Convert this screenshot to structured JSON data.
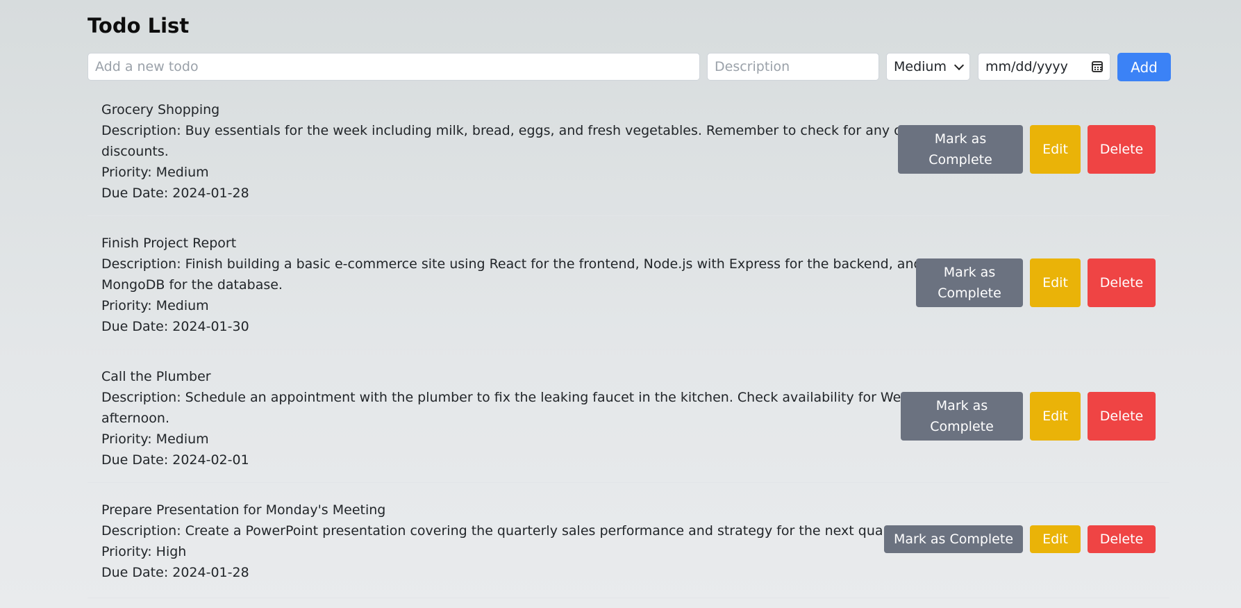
{
  "page": {
    "title": "Todo List"
  },
  "form": {
    "title_placeholder": "Add a new todo",
    "description_placeholder": "Description",
    "priority_selected": "Medium",
    "date_placeholder": "mm/dd/yyyy",
    "add_label": "Add"
  },
  "todos": [
    {
      "title": "Grocery Shopping",
      "description_line1": "Description: Buy essentials for the week including milk, bread, eggs, and fresh vegetables. Remember to check for any ongoing",
      "description_line2": "discounts.",
      "priority": "Priority: Medium",
      "due": "Due Date: 2024-01-28",
      "complete_label": "Mark as Complete",
      "edit_label": "Edit",
      "delete_label": "Delete"
    },
    {
      "title": "Finish Project Report",
      "description_line1": "Description: Finish building a basic e-commerce site using React for the frontend, Node.js with Express for the backend, and",
      "description_line2": "MongoDB for the database.",
      "priority": "Priority: Medium",
      "due": "Due Date: 2024-01-30",
      "complete_label": "Mark as Complete",
      "edit_label": "Edit",
      "delete_label": "Delete"
    },
    {
      "title": "Call the Plumber",
      "description_line1": "Description: Schedule an appointment with the plumber to fix the leaking faucet in the kitchen. Check availability for Wednesday",
      "description_line2": "afternoon.",
      "priority": "Priority: Medium",
      "due": "Due Date: 2024-02-01",
      "complete_label": "Mark as Complete",
      "edit_label": "Edit",
      "delete_label": "Delete"
    },
    {
      "title": "Prepare Presentation for Monday's Meeting",
      "description_line1": "Description: Create a PowerPoint presentation covering the quarterly sales performance and strategy for the next quarter.",
      "priority": "Priority: High",
      "due": "Due Date: 2024-01-28",
      "complete_label": "Mark as Complete",
      "edit_label": "Edit",
      "delete_label": "Delete"
    }
  ],
  "colors": {
    "complete_button": "#6b7280",
    "edit_button": "#eab308",
    "delete_button": "#ef4444",
    "add_button": "#3b82f6"
  }
}
